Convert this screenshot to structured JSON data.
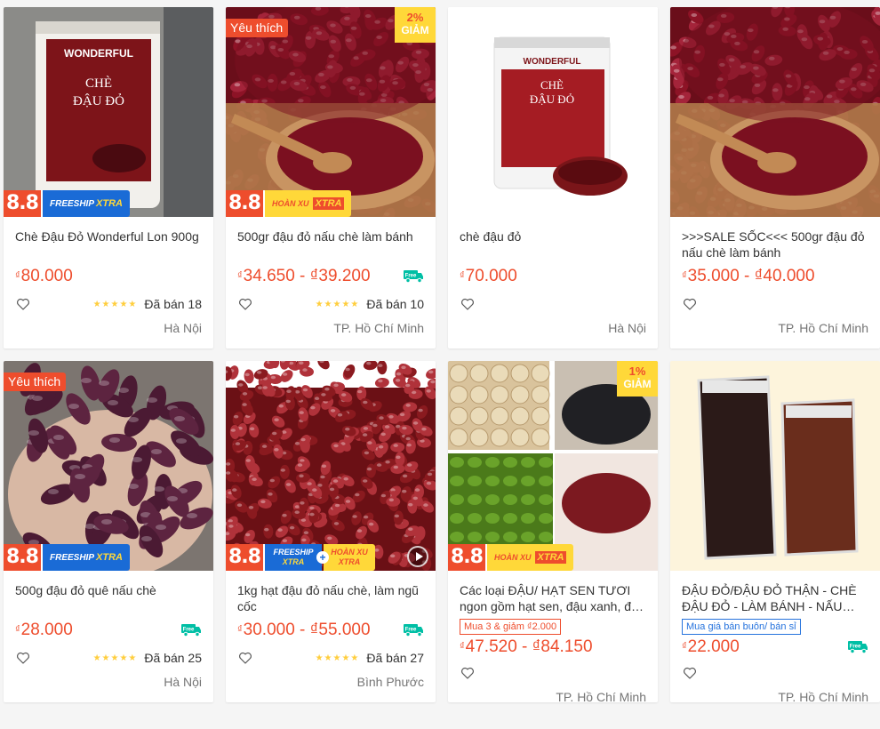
{
  "products": [
    {
      "title": "Chè Đậu Đỏ Wonderful Lon 900g",
      "price": "80.000",
      "stars": "★★★★★",
      "sold": "Đã bán 18",
      "location": "Hà Nội",
      "fav": "",
      "discount": "",
      "promo": "freeship",
      "tag": "",
      "freeship_icon": false,
      "image": "can-photo"
    },
    {
      "title": "500gr đậu đỏ nấu chè làm bánh",
      "price": "34.650 - ₫39.200",
      "stars": "★★★★★",
      "sold": "Đã bán 10",
      "location": "TP. Hồ Chí Minh",
      "fav": "Yêu thích",
      "discount": "2%",
      "promo": "hoanxu",
      "tag": "",
      "freeship_icon": true,
      "image": "beans-bowl"
    },
    {
      "title": "chè đậu đỏ",
      "price": "70.000",
      "stars": "",
      "sold": "",
      "location": "Hà Nội",
      "fav": "",
      "discount": "",
      "promo": "",
      "tag": "",
      "freeship_icon": false,
      "image": "can-white"
    },
    {
      "title": ">>>SALE SỐC<<< 500gr đậu đỏ nấu chè làm bánh",
      "price": "35.000 - ₫40.000",
      "stars": "",
      "sold": "",
      "location": "TP. Hồ Chí Minh",
      "fav": "",
      "discount": "",
      "promo": "",
      "tag": "",
      "freeship_icon": false,
      "image": "beans-bowl"
    },
    {
      "title": "500g đậu đỏ quê nấu chè",
      "price": "28.000",
      "stars": "★★★★★",
      "sold": "Đã bán 25",
      "location": "Hà Nội",
      "fav": "Yêu thích",
      "discount": "",
      "promo": "freeship",
      "tag": "",
      "freeship_icon": true,
      "image": "hand-beans"
    },
    {
      "title": "1kg hạt đậu đỏ nấu chè, làm ngũ cốc",
      "price": "30.000 - ₫55.000",
      "stars": "★★★★★",
      "sold": "Đã bán 27",
      "location": "Bình Phước",
      "fav": "",
      "discount": "",
      "promo": "combo",
      "tag": "",
      "freeship_icon": true,
      "image": "beans-pile"
    },
    {
      "title": "Các loại ĐẬU/ HẠT SEN TƯƠI ngon gồm hạt sen, đậu xanh, đậu đỏ",
      "price": "47.520 - ₫84.150",
      "stars": "",
      "sold": "",
      "location": "TP. Hồ Chí Minh",
      "fav": "",
      "discount": "1%",
      "promo": "hoanxu",
      "tag": "Mua 3 & giảm ₫2.000",
      "tag_style": "red",
      "freeship_icon": false,
      "image": "mixed"
    },
    {
      "title": "ĐẬU ĐỎ/ĐẬU ĐỎ THẬN - CHÈ ĐẬU ĐỎ - LÀM BÁNH - NẤU CHÈ",
      "price": "22.000",
      "stars": "",
      "sold": "",
      "location": "TP. Hồ Chí Minh",
      "fav": "",
      "discount": "",
      "promo": "",
      "tag": "Mua giá bán buôn/ bán sỉ",
      "tag_style": "blue",
      "freeship_icon": true,
      "image": "bags"
    }
  ],
  "labels": {
    "currency": "₫",
    "discount_word": "GIẢM",
    "sale_badge": "8.8",
    "freeship_text": "FREESHIP",
    "xtra_text": "XTRA",
    "hoanxu_text": "HOÀN XU",
    "free_icon_text": "Free"
  },
  "colors": {
    "accent": "#ee4d2d",
    "freeship_blue": "#1a6bd6",
    "yellow": "#ffd839"
  }
}
